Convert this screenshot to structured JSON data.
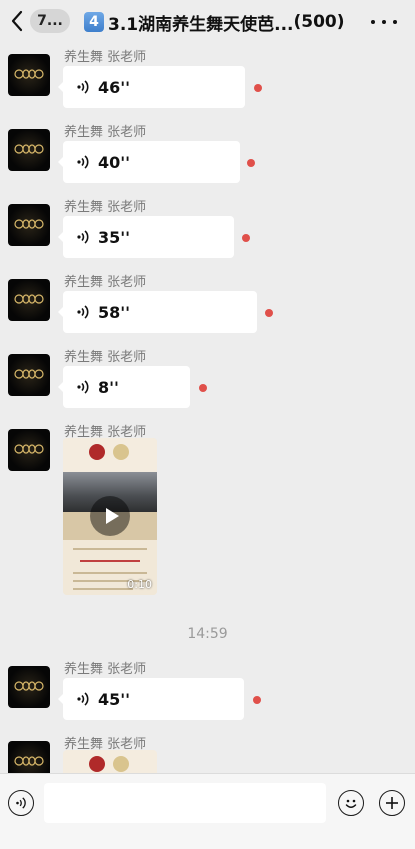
{
  "header": {
    "back_badge": "7...",
    "title_emoji": "4",
    "title": "3.1湖南养生舞天使芭...",
    "member_count": "(500)"
  },
  "colors": {
    "background": "#ededed",
    "bubble": "#ffffff",
    "unread_dot": "#e0504a",
    "sender_name": "#7a7a7a"
  },
  "messages": [
    {
      "type": "voice",
      "sender": "养生舞 张老师",
      "duration": "46''",
      "unread": true
    },
    {
      "type": "voice",
      "sender": "养生舞 张老师",
      "duration": "40''",
      "unread": true
    },
    {
      "type": "voice",
      "sender": "养生舞 张老师",
      "duration": "35''",
      "unread": true
    },
    {
      "type": "voice",
      "sender": "养生舞 张老师",
      "duration": "58''",
      "unread": true
    },
    {
      "type": "voice",
      "sender": "养生舞 张老师",
      "duration": "8''",
      "unread": true
    },
    {
      "type": "video",
      "sender": "养生舞 张老师",
      "video_duration": "0:10"
    },
    {
      "type": "timestamp",
      "text": "14:59"
    },
    {
      "type": "voice",
      "sender": "养生舞 张老师",
      "duration": "45''",
      "unread": true
    },
    {
      "type": "video",
      "sender": "养生舞 张老师",
      "partial": true
    }
  ],
  "input_bar": {
    "voice_icon": "voice-mode-icon",
    "emoji_icon": "emoji-icon",
    "plus_icon": "plus-icon",
    "placeholder": ""
  }
}
